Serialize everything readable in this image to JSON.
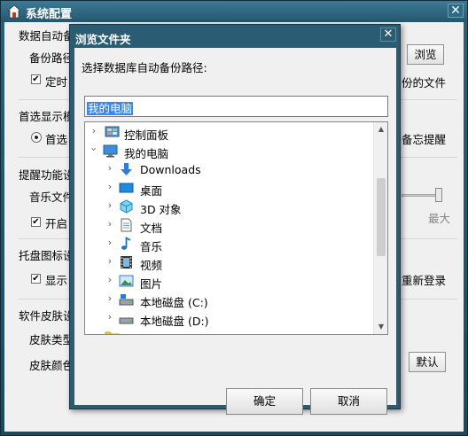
{
  "outer_window": {
    "title": "系统配置",
    "close_glyph": "✕",
    "left_labels": [
      "数据自动备",
      "备份路径",
      "定时",
      "首选显示模",
      "首选",
      "提醒功能设",
      "音乐文件",
      "开启",
      "托盘图标设",
      "显示",
      "软件皮肤设",
      "皮肤类型",
      "皮肤颜色"
    ],
    "browse_button": "浏览",
    "right_texts": {
      "backup_file": "份的文件",
      "memo_reminder": "备忘提醒",
      "max_volume": "最大",
      "relogin": "重新登录"
    },
    "default_button": "默认"
  },
  "dialog": {
    "title": "浏览文件夹",
    "close_glyph": "✕",
    "prompt": "选择数据库自动备份路径:",
    "path_value": "我的电脑",
    "tree": [
      {
        "label": "控制面板",
        "icon": "control-panel-icon",
        "expander": "collapsed",
        "level": 0
      },
      {
        "label": "我的电脑",
        "icon": "computer-icon",
        "expander": "expanded",
        "level": 0
      },
      {
        "label": "Downloads",
        "icon": "downloads-icon",
        "expander": "collapsed",
        "level": 1
      },
      {
        "label": "桌面",
        "icon": "desktop-icon",
        "expander": "collapsed",
        "level": 1
      },
      {
        "label": "3D 对象",
        "icon": "3d-objects-icon",
        "expander": "collapsed",
        "level": 1
      },
      {
        "label": "文档",
        "icon": "documents-icon",
        "expander": "collapsed",
        "level": 1
      },
      {
        "label": "音乐",
        "icon": "music-icon",
        "expander": "collapsed",
        "level": 1
      },
      {
        "label": "视频",
        "icon": "video-icon",
        "expander": "collapsed",
        "level": 1
      },
      {
        "label": "图片",
        "icon": "pictures-icon",
        "expander": "collapsed",
        "level": 1
      },
      {
        "label": "本地磁盘 (C:)",
        "icon": "drive-icon",
        "expander": "collapsed",
        "level": 1
      },
      {
        "label": "本地磁盘 (D:)",
        "icon": "drive-icon",
        "expander": "collapsed",
        "level": 1
      }
    ],
    "ok_button": "确定",
    "cancel_button": "取消"
  },
  "colors": {
    "title_bar": "#2a5d74",
    "selection": "#3388ff"
  }
}
